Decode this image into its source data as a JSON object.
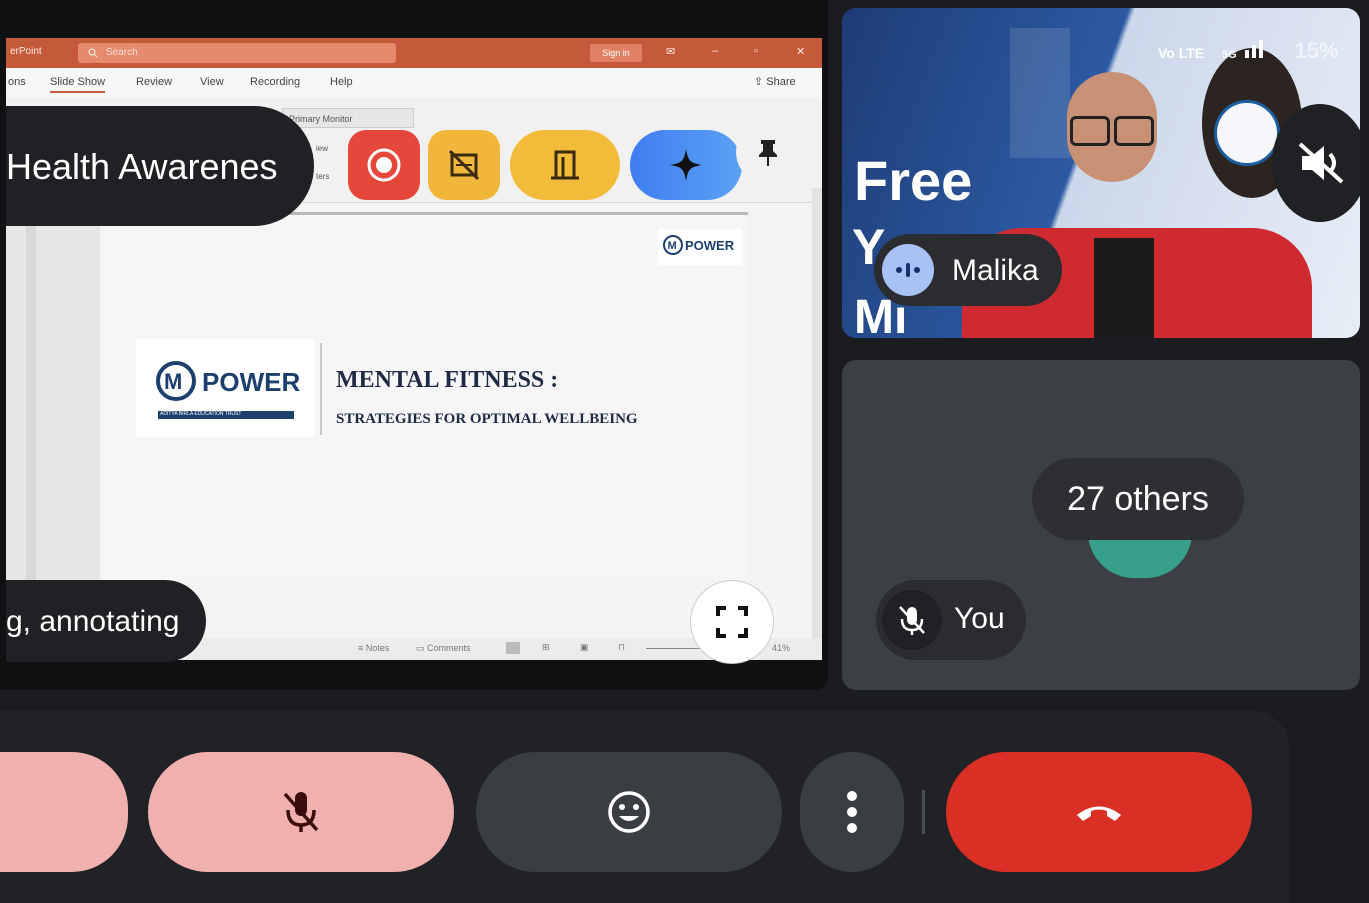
{
  "powerpoint": {
    "app_label": "erPoint",
    "search_placeholder": "Search",
    "sign_in": "Sign in",
    "menu": [
      "ons",
      "Slide Show",
      "Review",
      "View",
      "Recording",
      "Help"
    ],
    "share": "Share",
    "ribbon_monitor": "Primary Monitor",
    "ribbon_small": [
      "iew",
      "ters"
    ],
    "status": [
      "Notes",
      "Comments"
    ],
    "zoom": "41%"
  },
  "slide": {
    "logo_text": "POWER",
    "logo_tagline": "ADITYA BIRLA EDUCATION TRUST",
    "title": "MENTAL FITNESS :",
    "subtitle": "STRATEGIES FOR OPTIMAL WELLBEING",
    "corner_logo": "POWER"
  },
  "meeting": {
    "caption_title": "Health Awarenes",
    "caption_line": "g, annotating",
    "speaker_name": "Malika",
    "video_backdrop_text": "Free",
    "video_backdrop_text2": "Y",
    "video_backdrop_text3": "Mi",
    "phone_status": {
      "network": "Vo LTE",
      "signal": "5G",
      "battery": "15%"
    },
    "others_label": "27 others",
    "self_label": "You"
  },
  "colors": {
    "end_call": "#d92f25",
    "mic_muted_bg": "#f0b0ae",
    "control_bg": "#3a3d42",
    "gemini_blue": "#4c8df2",
    "record_red": "#e5473a",
    "amber": "#f0b73b"
  },
  "icons": [
    "search-icon",
    "record-icon",
    "hide-icon",
    "door-icon",
    "gemini-icon",
    "pin-icon",
    "fullscreen-icon",
    "speaking-icon",
    "volume-off-icon",
    "mic-off-icon",
    "emoji-icon",
    "more-vert-icon",
    "end-call-icon"
  ]
}
